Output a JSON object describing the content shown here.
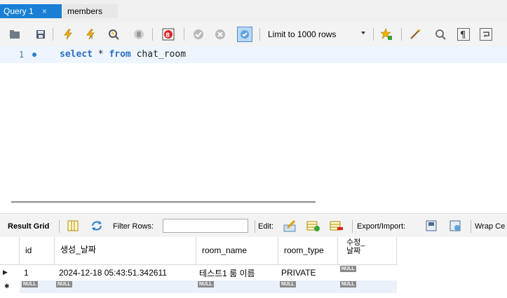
{
  "tabs": [
    {
      "label": "Query 1",
      "close": "×",
      "active": true
    },
    {
      "label": "members",
      "active": false
    }
  ],
  "toolbar": {
    "limit_label": "Limit to 1000 rows",
    "icons": [
      "open-folder-icon",
      "save-icon",
      "execute-icon",
      "execute-current-icon",
      "explain-icon",
      "stop-icon",
      "toggle-error-icon",
      "commit-icon",
      "rollback-icon",
      "autocommit-icon",
      "add-snippet-icon",
      "beautify-icon",
      "find-icon",
      "invisible-chars-icon",
      "wrap-icon"
    ]
  },
  "editor": {
    "line_number": "1",
    "code": {
      "k1": "select",
      "star": " * ",
      "k2": "from",
      "table": " chat_room"
    }
  },
  "result_toolbar": {
    "result_grid": "Result Grid",
    "filter_rows": "Filter Rows:",
    "edit": "Edit:",
    "export_import": "Export/Import:",
    "wrap": "Wrap Ce"
  },
  "grid": {
    "columns": [
      "id",
      "생성_날짜",
      "room_name",
      "room_type",
      "수정_\n날짜"
    ],
    "rows": [
      {
        "indicator": "▶",
        "id": "1",
        "created": "2024-12-18 05:43:51.342611",
        "room_name": "테스트1 룸 이름",
        "room_type": "PRIVATE",
        "updated": "NULL"
      }
    ],
    "new_row": {
      "indicator": "✱",
      "null": "NULL"
    }
  }
}
